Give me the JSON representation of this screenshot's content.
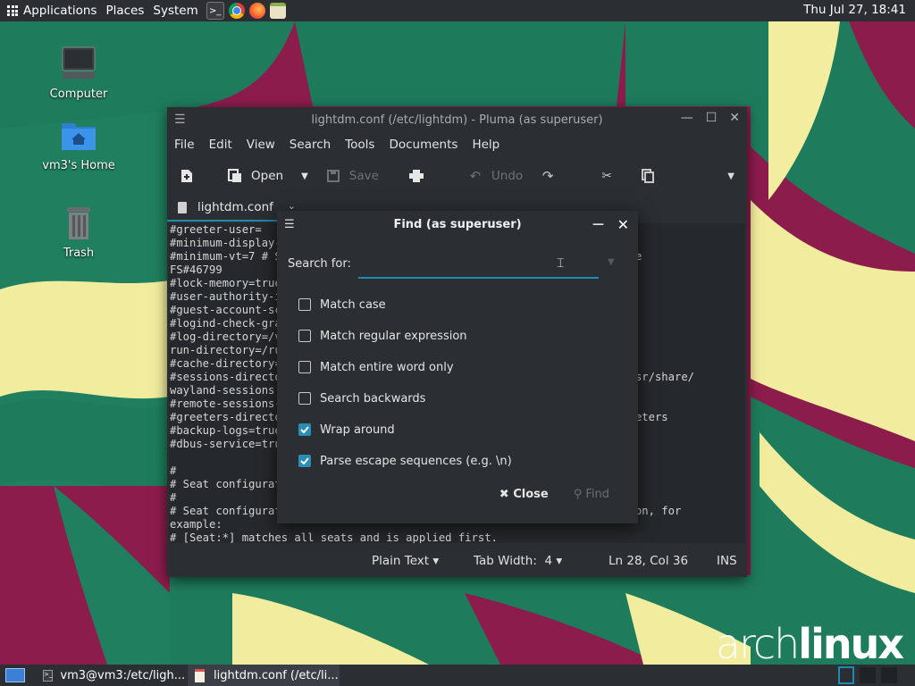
{
  "top_panel": {
    "applications": "Applications",
    "places": "Places",
    "system": "System",
    "clock": "Thu Jul 27, 18:41"
  },
  "desktop": {
    "icons": [
      {
        "label": "Computer"
      },
      {
        "label": "vm3's Home"
      },
      {
        "label": "Trash"
      }
    ],
    "brand": {
      "light": "arch",
      "bold": "linux"
    }
  },
  "window": {
    "title": "lightdm.conf (/etc/lightdm) - Pluma (as superuser)",
    "menu": [
      "File",
      "Edit",
      "View",
      "Search",
      "Tools",
      "Documents",
      "Help"
    ],
    "toolbar": {
      "open": "Open",
      "save": "Save",
      "undo": "Undo"
    },
    "tab": "lightdm.conf",
    "editor_lines": [
      "#greeter-user=",
      "#minimum-display-number=0",
      "#minimum-vt=7 # Setting this to a value < 7 implies security issues, see",
      "FS#46799",
      "#lock-memory=true",
      "#user-authority-in-system-dir=false",
      "#guest-account-script=guest-account",
      "#logind-check-graphical=true",
      "#log-directory=/var/log/lightdm",
      "run-directory=/run/lightdm",
      "#cache-directory=/var/cache/lightdm",
      "#sessions-directory=/usr/share/lightdm/sessions:/usr/share/xsessions:/usr/share/",
      "wayland-sessions",
      "#remote-sessions-directory=/usr/share/lightdm/remote-sessions",
      "#greeters-directory=$XDG_DATA_DIRS/lightdm/greeters:$XDG_DATA_DIRS/xgreeters",
      "#backup-logs=true",
      "#dbus-service=true",
      "",
      "#",
      "# Seat configuration",
      "#",
      "# Seat configuration is matched against the seat name glob in the section, for",
      "example:",
      "# [Seat:*] matches all seats and is applied first."
    ],
    "status": {
      "language": "Plain Text",
      "tab_width_label": "Tab Width:",
      "tab_width_value": "4",
      "position": "Ln 28, Col 36",
      "mode": "INS"
    }
  },
  "find_dialog": {
    "title": "Find (as superuser)",
    "search_label": "Search for:",
    "search_value": "",
    "options": [
      {
        "label": "Match case",
        "checked": false
      },
      {
        "label": "Match regular expression",
        "checked": false
      },
      {
        "label": "Match entire word only",
        "checked": false
      },
      {
        "label": "Search backwards",
        "checked": false
      },
      {
        "label": "Wrap around",
        "checked": true
      },
      {
        "label": "Parse escape sequences (e.g. \\n)",
        "checked": true
      }
    ],
    "close_label": "Close",
    "find_label": "Find"
  },
  "taskbar": {
    "tasks": [
      {
        "label": "vm3@vm3:/etc/ligh..."
      },
      {
        "label": "lightdm.conf (/etc/li..."
      }
    ]
  },
  "colors": {
    "accent": "#1e8ab0",
    "wallpaper_magenta": "#8c1c4c",
    "wallpaper_green": "#1e7c5c",
    "wallpaper_cream": "#f4f0a8"
  }
}
